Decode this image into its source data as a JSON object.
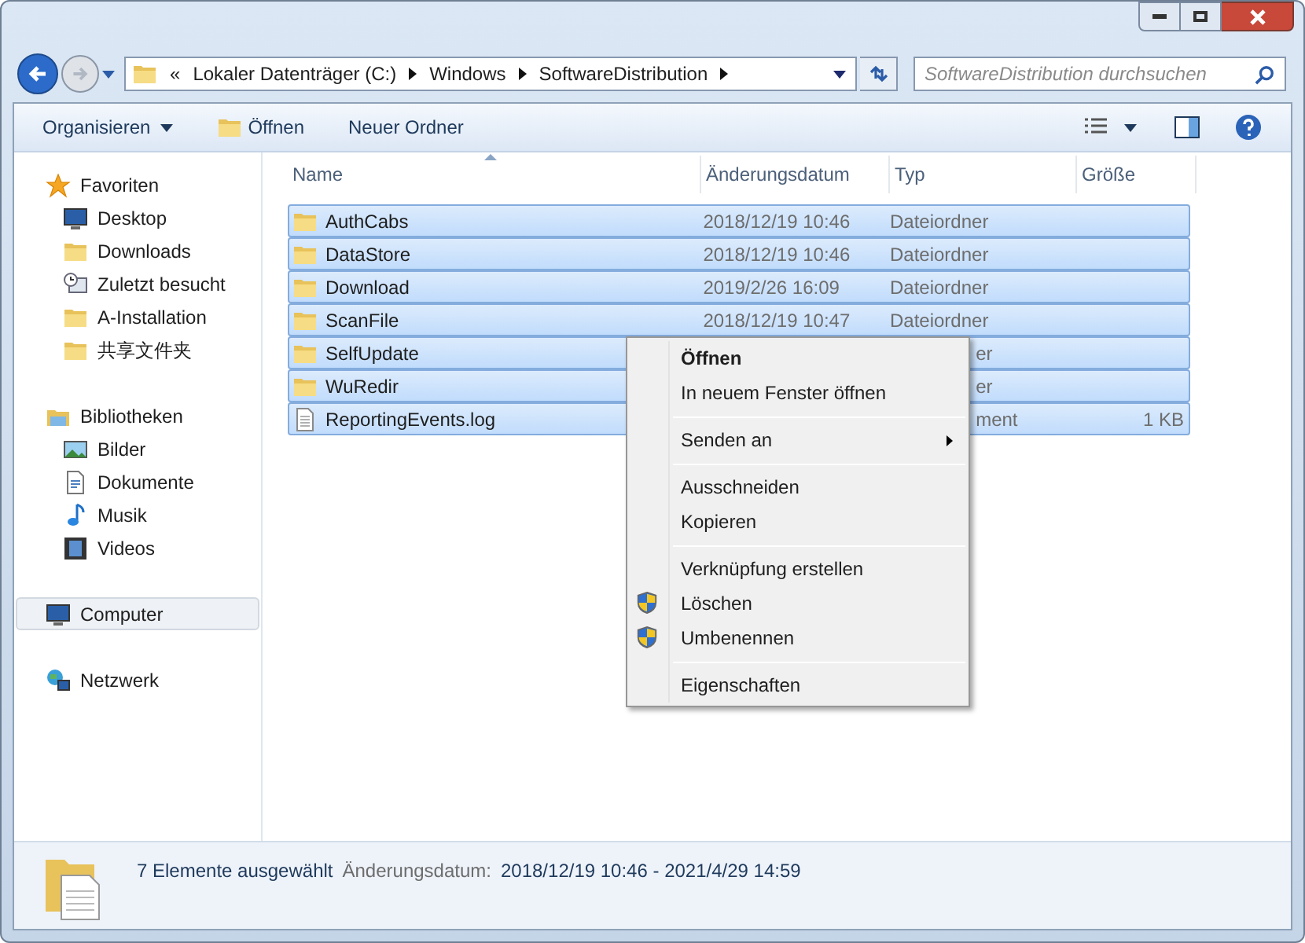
{
  "address_bar": {
    "overflow": "«",
    "segments": [
      "Lokaler Datenträger (C:)",
      "Windows",
      "SoftwareDistribution"
    ]
  },
  "search": {
    "placeholder": "SoftwareDistribution durchsuchen"
  },
  "toolbar": {
    "items": [
      "Organisieren",
      "Öffnen",
      "Neuer Ordner"
    ]
  },
  "sidebar": {
    "groups": [
      {
        "label": "Favoriten",
        "selected": false,
        "children": [
          {
            "label": "Desktop",
            "selected": false
          },
          {
            "label": "Downloads",
            "selected": false
          },
          {
            "label": "Zuletzt besucht",
            "selected": false
          },
          {
            "label": "A-Installation",
            "selected": false
          },
          {
            "label": "共享文件夹",
            "selected": false
          }
        ]
      },
      {
        "label": "Bibliotheken",
        "selected": false,
        "children": [
          {
            "label": "Bilder",
            "selected": false
          },
          {
            "label": "Dokumente",
            "selected": false
          },
          {
            "label": "Musik",
            "selected": false
          },
          {
            "label": "Videos",
            "selected": false
          }
        ]
      },
      {
        "label": "Computer",
        "selected": true
      },
      {
        "label": "Netzwerk",
        "selected": false
      }
    ]
  },
  "table": {
    "columns": [
      "Name",
      "Änderungsdatum",
      "Typ",
      "Größe"
    ],
    "rows": [
      {
        "kind": "folder",
        "name": "AuthCabs",
        "date": "2018/12/19 10:46",
        "type": "Dateiordner",
        "selected": true
      },
      {
        "kind": "folder",
        "name": "DataStore",
        "date": "2018/12/19 10:46",
        "type": "Dateiordner",
        "selected": true
      },
      {
        "kind": "folder",
        "name": "Download",
        "date": "2019/2/26 16:09",
        "type": "Dateiordner",
        "selected": true
      },
      {
        "kind": "folder",
        "name": "ScanFile",
        "date": "2018/12/19 10:47",
        "type": "Dateiordner",
        "selected": true
      },
      {
        "kind": "folder",
        "name": "SelfUpdate",
        "type": "er",
        "selected": true
      },
      {
        "kind": "folder",
        "name": "WuRedir",
        "type": "er",
        "selected": true
      },
      {
        "kind": "file",
        "name": "ReportingEvents.log",
        "type": "ment",
        "size": "1 KB",
        "selected": true
      }
    ]
  },
  "context_menu": {
    "items": [
      {
        "kind": "item",
        "label": "Öffnen",
        "bold": true
      },
      {
        "kind": "item",
        "label": "In neuem Fenster öffnen"
      },
      {
        "kind": "separator"
      },
      {
        "kind": "item",
        "label": "Senden an",
        "submenu": true
      },
      {
        "kind": "separator"
      },
      {
        "kind": "item",
        "label": "Ausschneiden"
      },
      {
        "kind": "item",
        "label": "Kopieren"
      },
      {
        "kind": "separator"
      },
      {
        "kind": "item",
        "label": "Verknüpfung erstellen"
      },
      {
        "kind": "item",
        "label": "Löschen",
        "shield": true
      },
      {
        "kind": "item",
        "label": "Umbenennen",
        "shield": true
      },
      {
        "kind": "separator"
      },
      {
        "kind": "item",
        "label": "Eigenschaften"
      }
    ]
  },
  "status_bar": {
    "count": "7 Elemente ausgewählt",
    "label": "Änderungsdatum:",
    "value": "2018/12/19 10:46 - 2021/4/29 14:59"
  }
}
